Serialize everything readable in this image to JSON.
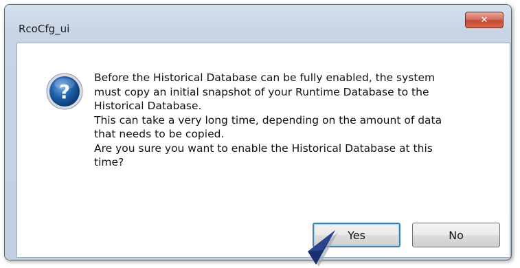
{
  "window": {
    "title": "RcoCfg_ui",
    "close_glyph": "✕"
  },
  "icon": {
    "name": "question-icon",
    "glyph": "?",
    "color": "#1f5fa8"
  },
  "message": {
    "lines": [
      "Before the Historical Database can be fully enabled, the system",
      "must copy an initial snapshot of your Runtime Database to the",
      "Historical Database.",
      "This can take a very long time, depending on the amount of data",
      "that needs to be copied.",
      "Are you sure you want to enable the Historical Database at this",
      "time?"
    ]
  },
  "buttons": {
    "yes_label": "Yes",
    "no_label": "No"
  },
  "colors": {
    "title_bar": "#c6d4e4",
    "close_button": "#c24a36",
    "focus_border": "#3c7fb1",
    "cursor": "#1a2f6e"
  }
}
